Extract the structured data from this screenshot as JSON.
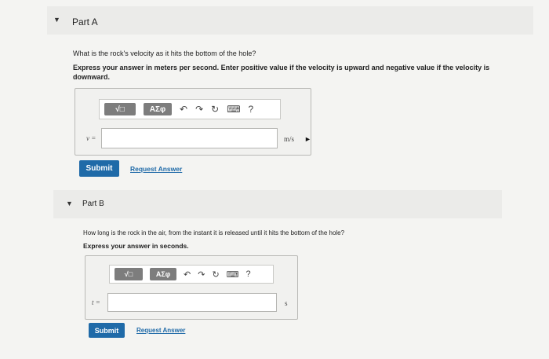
{
  "part_a": {
    "title": "Part A",
    "question": "What is the rock's velocity as it hits the bottom of the hole?",
    "instruction": "Express your answer in meters per second. Enter positive value if the velocity is upward and negative value if the velocity is downward.",
    "variable": "v =",
    "value": "",
    "unit": "m/s",
    "submit_label": "Submit",
    "request_label": "Request Answer"
  },
  "part_b": {
    "title": "Part B",
    "question": "How long is the rock in the air, from the instant it is released until it hits the bottom of the hole?",
    "instruction": "Express your answer in seconds.",
    "variable": "t =",
    "value": "",
    "unit": "s",
    "submit_label": "Submit",
    "request_label": "Request Answer"
  },
  "toolbar": {
    "template_label": "√□",
    "greek_label": "ΑΣφ",
    "help_label": "?"
  },
  "colors": {
    "accent": "#1f6aa8",
    "toolbar_button": "#7d7d7d"
  }
}
